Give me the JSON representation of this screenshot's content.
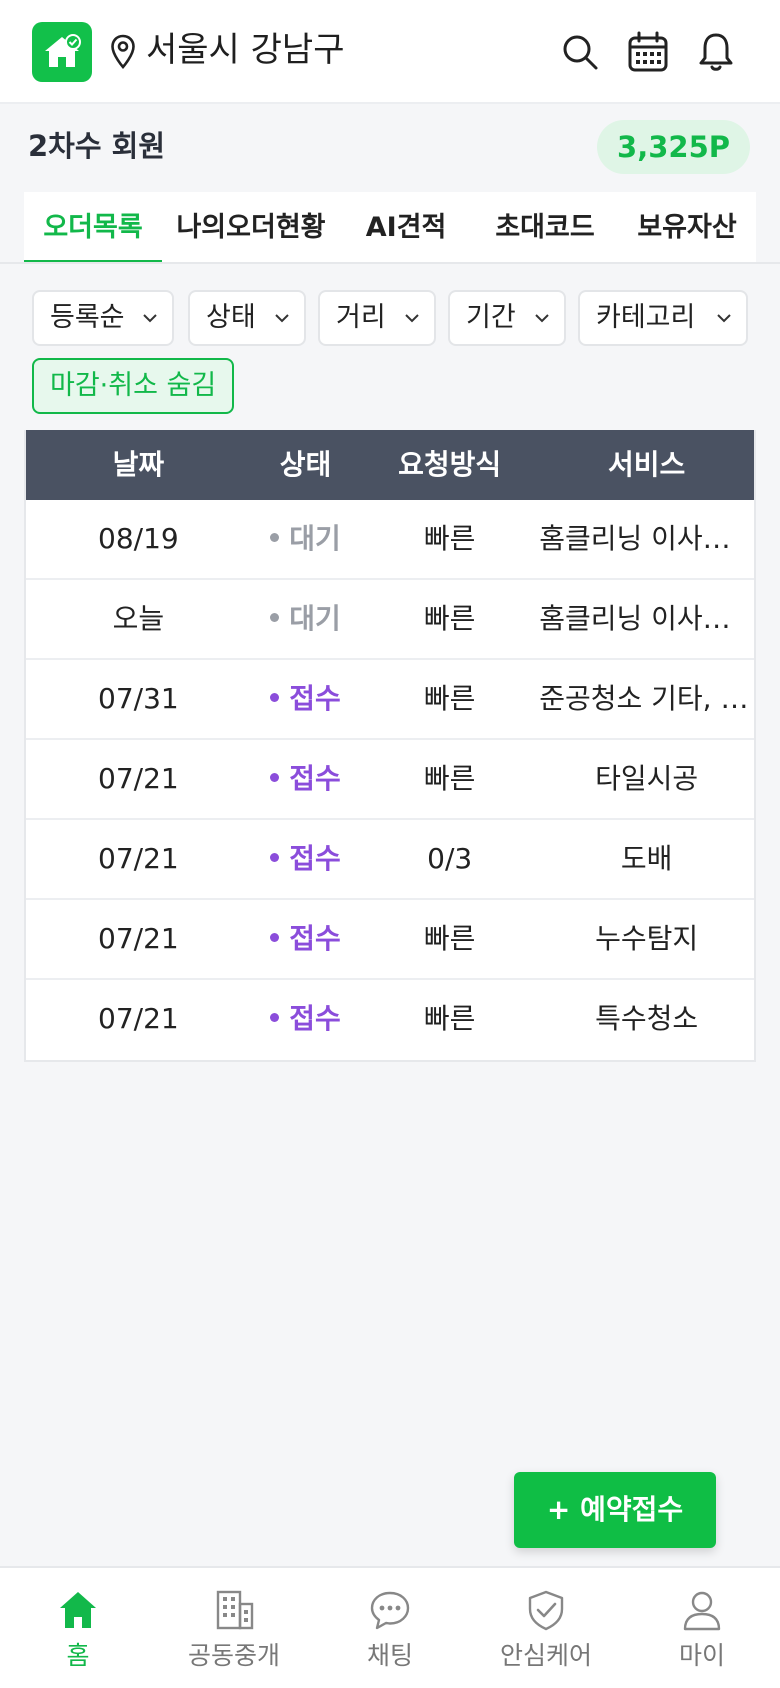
{
  "header": {
    "location": "서울시 강남구",
    "icons": [
      "home-logo-icon",
      "location-pin-icon",
      "search-icon",
      "calendar-icon",
      "bell-icon"
    ]
  },
  "member": {
    "grade": "2차수 회원",
    "points": "3,325P"
  },
  "tabs": [
    {
      "label": "오더목록",
      "active": true
    },
    {
      "label": "나의오더현황",
      "active": false
    },
    {
      "label": "AI견적",
      "active": false
    },
    {
      "label": "초대코드",
      "active": false
    },
    {
      "label": "보유자산",
      "active": false
    }
  ],
  "filters": {
    "chips": [
      "등록순",
      "상태",
      "거리",
      "기간",
      "카테고리"
    ],
    "toggle": "마감·취소 숨김"
  },
  "table": {
    "headers": [
      "날짜",
      "상태",
      "요청방식",
      "서비스"
    ],
    "rows": [
      {
        "date": "08/19",
        "status": "대기",
        "method": "빠른",
        "service": "홈클리닝 이사청소"
      },
      {
        "date": "오늘",
        "status": "대기",
        "method": "빠른",
        "service": "홈클리닝 이사청소"
      },
      {
        "date": "07/31",
        "status": "접수",
        "method": "빠른",
        "service": "준공청소 기타, 특..."
      },
      {
        "date": "07/21",
        "status": "접수",
        "method": "빠른",
        "service": "타일시공"
      },
      {
        "date": "07/21",
        "status": "접수",
        "method": "0/3",
        "service": "도배"
      },
      {
        "date": "07/21",
        "status": "접수",
        "method": "빠른",
        "service": "누수탐지"
      },
      {
        "date": "07/21",
        "status": "접수",
        "method": "빠른",
        "service": "특수청소"
      }
    ]
  },
  "fab": {
    "label": "+ 예약접수"
  },
  "bottom_nav": [
    {
      "label": "홈",
      "icon": "home-icon",
      "active": true
    },
    {
      "label": "공동중개",
      "icon": "building-icon",
      "active": false
    },
    {
      "label": "채팅",
      "icon": "chat-icon",
      "active": false
    },
    {
      "label": "안심케어",
      "icon": "shield-check-icon",
      "active": false
    },
    {
      "label": "마이",
      "icon": "user-icon",
      "active": false
    }
  ],
  "colors": {
    "brand_green": "#12b84a",
    "status_wait": "#9a9ea6",
    "status_received": "#8b4ddb",
    "table_header": "#4a5262"
  }
}
